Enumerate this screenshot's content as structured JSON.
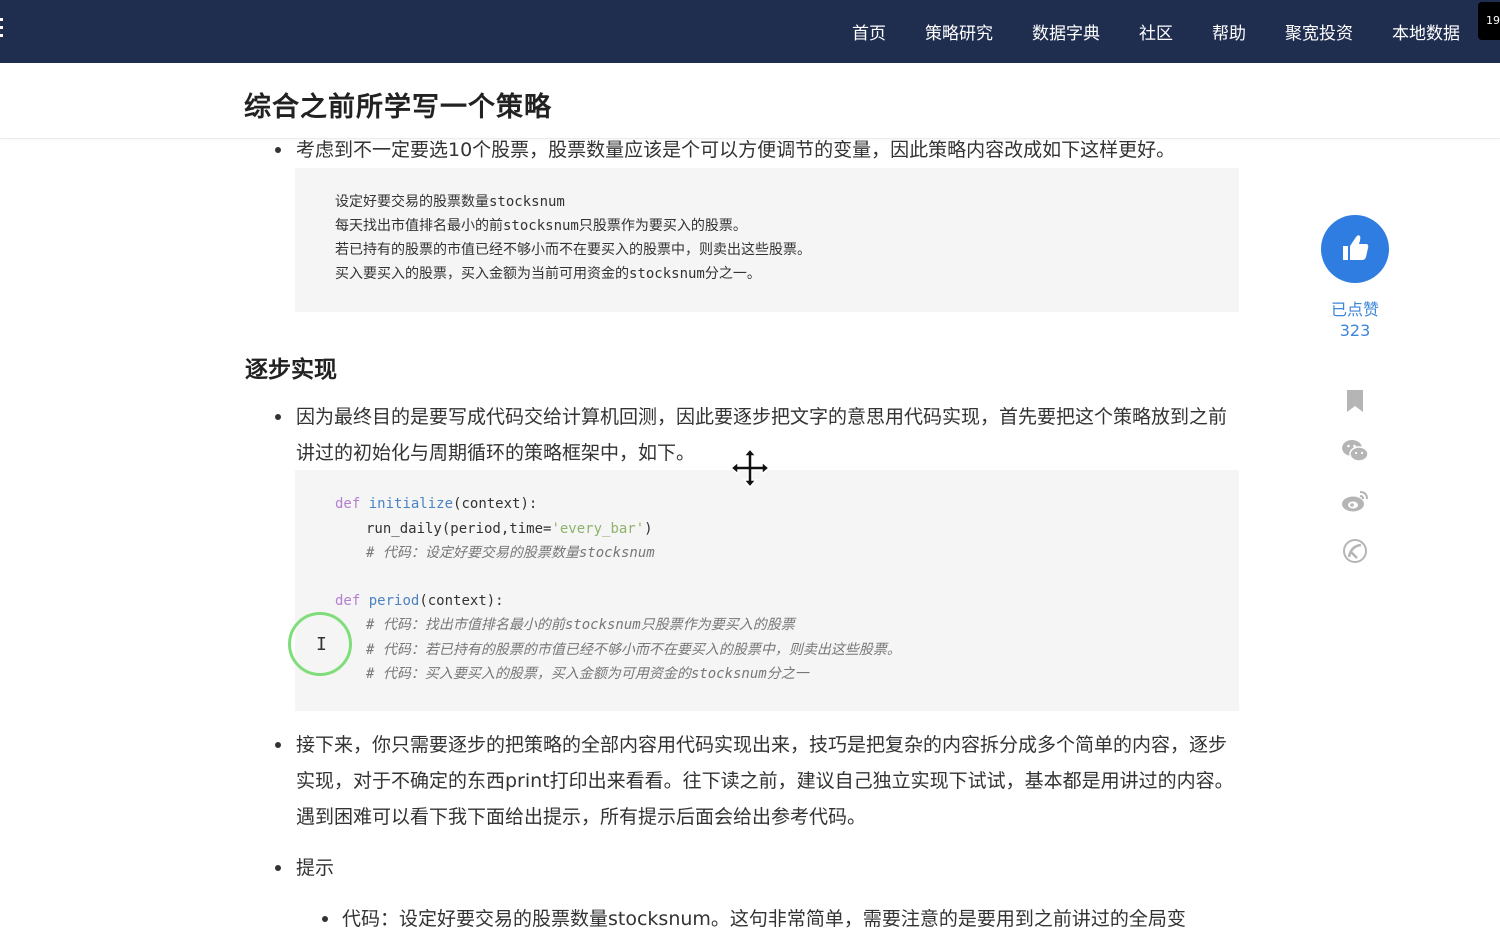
{
  "nav": {
    "items": [
      "首页",
      "策略研究",
      "数据字典",
      "社区",
      "帮助",
      "聚宽投资",
      "本地数据"
    ],
    "corner_tab": "19"
  },
  "title": "综合之前所学写一个策略",
  "article": {
    "bullet1": "考虑到不一定要选10个股票，股票数量应该是个可以方便调节的变量，因此策略内容改成如下这样更好。",
    "box1_lines": [
      "设定好要交易的股票数量stocksnum",
      "每天找出市值排名最小的前stocksnum只股票作为要买入的股票。",
      "若已持有的股票的市值已经不够小而不在要买入的股票中，则卖出这些股票。",
      "买入要买入的股票，买入金额为当前可用资金的stocksnum分之一。"
    ],
    "heading": "逐步实现",
    "bullet2": "因为最终目的是要写成代码交给计算机回测，因此要逐步把文字的意思用代码实现，首先要把这个策略放到之前讲过的初始化与周期循环的策略框架中，如下。",
    "code": {
      "def": "def",
      "fn1": "initialize",
      "arg1": "(context):",
      "call_pre": "run_daily(period,time=",
      "call_str": "'every_bar'",
      "call_post": ")",
      "c1": "# 代码：设定好要交易的股票数量stocksnum",
      "fn2": "period",
      "arg2": "(context):",
      "c2": "# 代码：找出市值排名最小的前stocksnum只股票作为要买入的股票",
      "c3": "# 代码：若已持有的股票的市值已经不够小而不在要买入的股票中，则卖出这些股票。",
      "c4": "# 代码：买入要买入的股票，买入金额为可用资金的stocksnum分之一"
    },
    "bullet3": "接下来，你只需要逐步的把策略的全部内容用代码实现出来，技巧是把复杂的内容拆分成多个简单的内容，逐步实现，对于不确定的东西print打印出来看看。往下读之前，建议自己独立实现下试试，基本都是用讲过的内容。遇到困难可以看下我下面给出提示，所有提示后面会给出参考代码。",
    "bullet4": "提示",
    "sub1": "代码：设定好要交易的股票数量stocksnum。这句非常简单，需要注意的是要用到之前讲过的全局变"
  },
  "side": {
    "like_label": "已点赞",
    "like_count": "323",
    "icons": [
      "thumbs-up-icon",
      "bookmark-icon",
      "wechat-icon",
      "weibo-icon",
      "other-share-icon"
    ]
  },
  "colors": {
    "nav_bg": "#1f2d4f",
    "like_blue": "#2f7de1",
    "code_bg": "#f5f5f5",
    "click_ring": "#7fdd7a"
  }
}
